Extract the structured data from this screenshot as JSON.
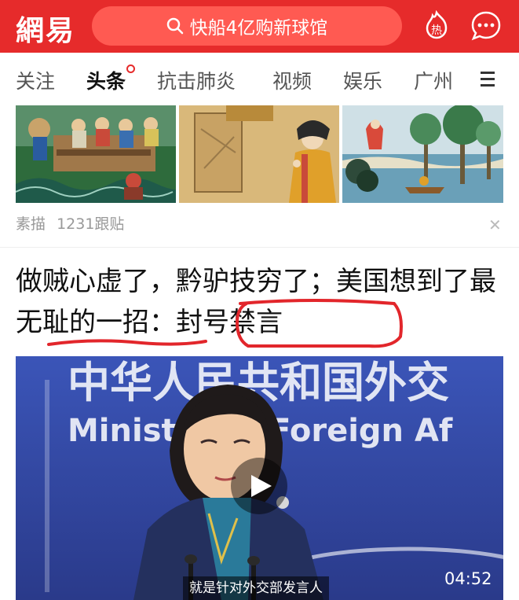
{
  "header": {
    "logo": "網易",
    "search_placeholder": "快船4亿购新球馆",
    "hot_label": "热",
    "icons": [
      "search-icon",
      "hot-icon",
      "chat-icon"
    ],
    "colors": {
      "brand": "#e62b2b",
      "search_bg": "#ff5a52"
    }
  },
  "tabs": [
    {
      "label": "关注"
    },
    {
      "label": "头条",
      "active": true
    },
    {
      "label": "抗击肺炎"
    },
    {
      "label": "视频"
    },
    {
      "label": "娱乐"
    },
    {
      "label": "广州"
    }
  ],
  "gallery_item": {
    "category": "素描",
    "comments": "1231跟贴"
  },
  "article": {
    "title": "做贼心虚了，黔驴技穷了；美国想到了最无耻的一招：封号禁言"
  },
  "video": {
    "backdrop_text_cn": "中华人民共和国外交",
    "backdrop_text_en": "Ministry of Foreign Af",
    "duration": "04:52",
    "subtitle": "就是针对外交部发言人"
  }
}
